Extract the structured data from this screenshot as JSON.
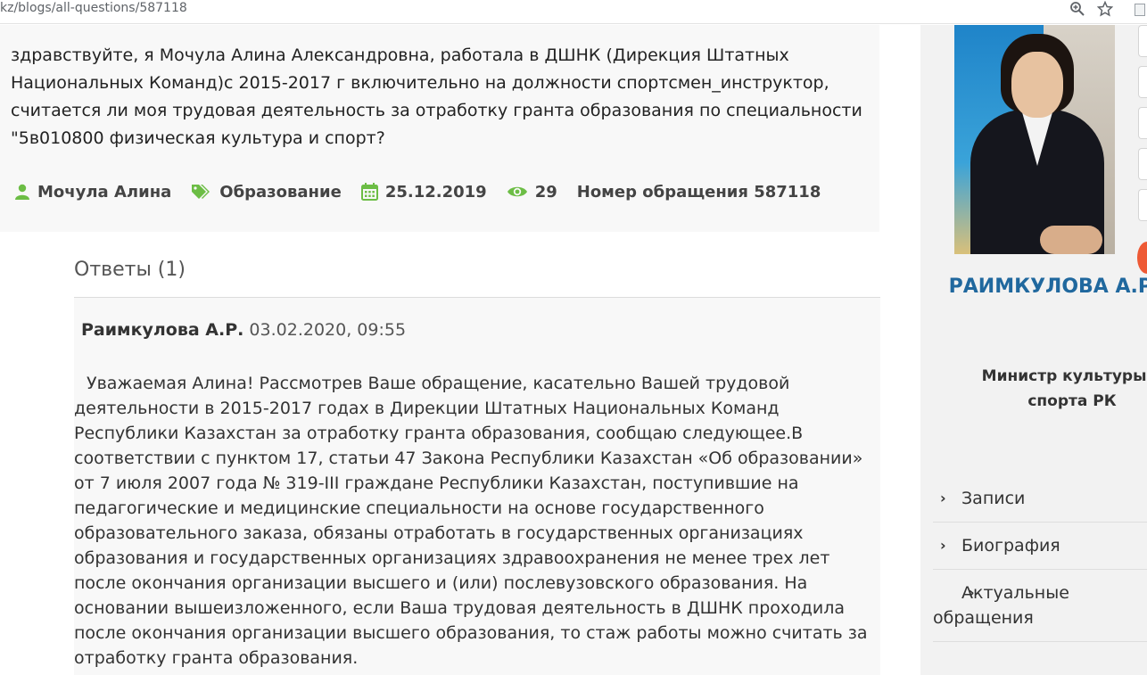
{
  "browser": {
    "url": "kz/blogs/all-questions/587118",
    "zoom_icon": "zoom-icon",
    "star_icon": "star-icon"
  },
  "question": {
    "text": "здравствуйте, я Мочула Алина Александровна, работала в ДШНК (Дирекция Штатных Национальных Команд)с 2015-2017 г включительно на должности спортсмен_инструктор, считается ли моя трудовая деятельность за отработку гранта образования по специальности \"5в010800 физическая культура и спорт?",
    "author": "Мочула Алина",
    "category": "Образование",
    "date": "25.12.2019",
    "views": "29",
    "request_number": "Номер обращения 587118",
    "accent_color": "#6cbd45"
  },
  "answers": {
    "title": "Ответы (1)",
    "items": [
      {
        "author": "Раимкулова А.Р.",
        "datetime": "03.02.2020, 09:55",
        "text": "Уважаемая Алина! Рассмотрев Ваше обращение, касательно Вашей трудовой деятельности в 2015-2017 годах в Дирекции Штатных Национальных Команд Республики Казахстан за отработку гранта образования, сообщаю следующее.В соответствии с пунктом 17, статьи 47 Закона Республики Казахстан «Об образовании» от 7 июля 2007 года № 319-III граждане Республики Казахстан, поступившие на педагогические и медицинские специальности на основе государственного образовательного заказа, обязаны отработать в государственных организациях образования и государственных организациях здравоохранения не менее трех лет после окончания организации высшего и (или) послевузовского образования. На основании вышеизложенного, если Ваша трудовая деятельность в ДШНК проходила после окончания организации высшего образования, то стаж работы можно считать за отработку гранта образования."
      }
    ]
  },
  "sidebar": {
    "minister_name": "РАИМКУЛОВА А.Р.",
    "minister_post": "Министр культуры и спорта РК",
    "name_color": "#20689e",
    "nav": [
      {
        "label": "Записи"
      },
      {
        "label": "Биография"
      },
      {
        "label": "Актуальные обращения"
      }
    ]
  }
}
